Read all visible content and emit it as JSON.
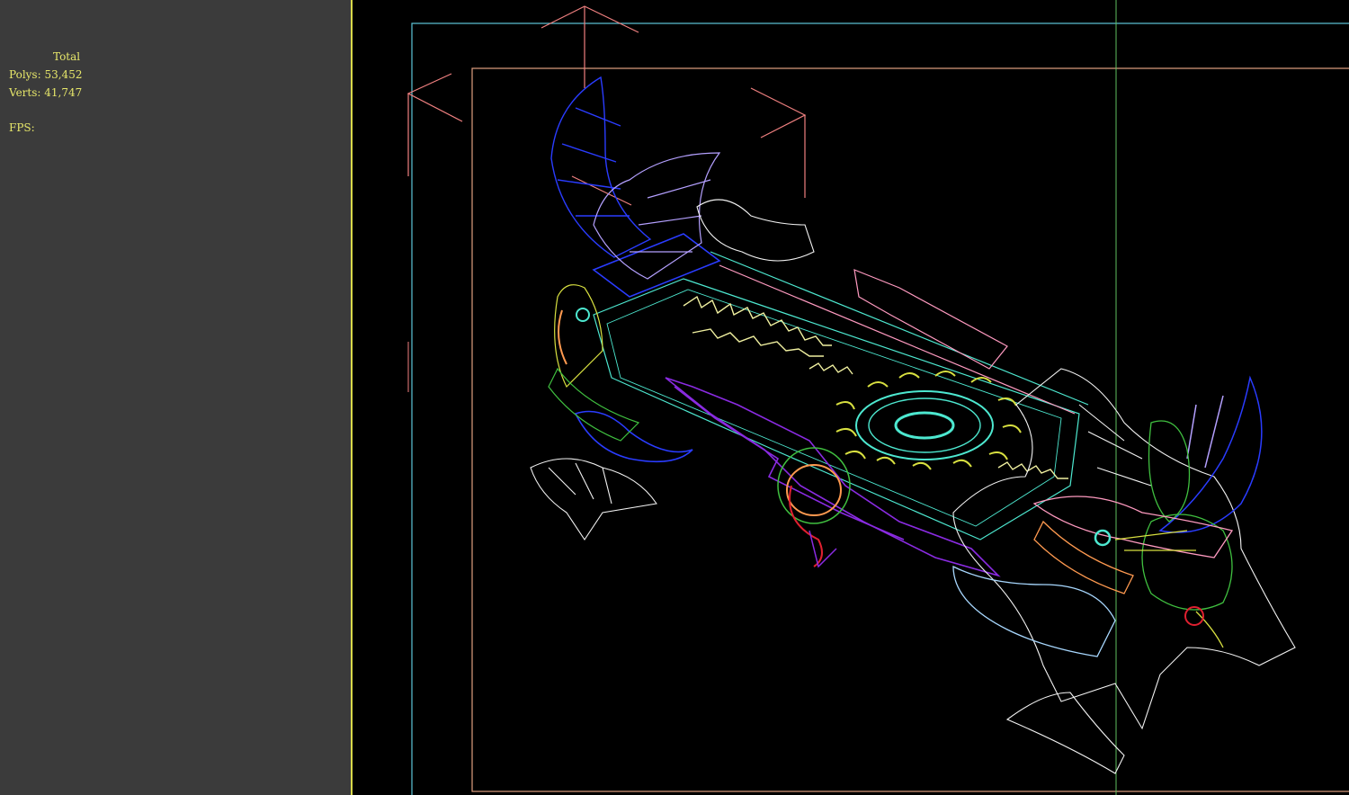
{
  "stats": {
    "total_label": "Total",
    "polys_label": "Polys:",
    "polys_value": "53,452",
    "verts_label": "Verts:",
    "verts_value": "41,747",
    "fps_label": "FPS:"
  },
  "colors": {
    "stats_text": "#e7e76a",
    "left_viewport_bg": "#3b3b3b",
    "main_viewport_bg": "#000000",
    "divider": "#d8d84a",
    "safe_frame_outer": "#5ec6d8",
    "safe_frame_inner": "#e0a080",
    "camera_gizmo": "#f08080",
    "wire_white": "#f2f2f2",
    "wire_cyan": "#4de8d0",
    "wire_yellow": "#d8e040",
    "wire_blue": "#2a3cff",
    "wire_purple": "#8a2be2",
    "wire_pink": "#ff9ac0",
    "wire_orange": "#ff9a50",
    "wire_green": "#40c040",
    "wire_light_blue": "#a8d8ff",
    "wire_red": "#e02030"
  },
  "model": {
    "icon": "wireframe-dragon-blade-model"
  }
}
